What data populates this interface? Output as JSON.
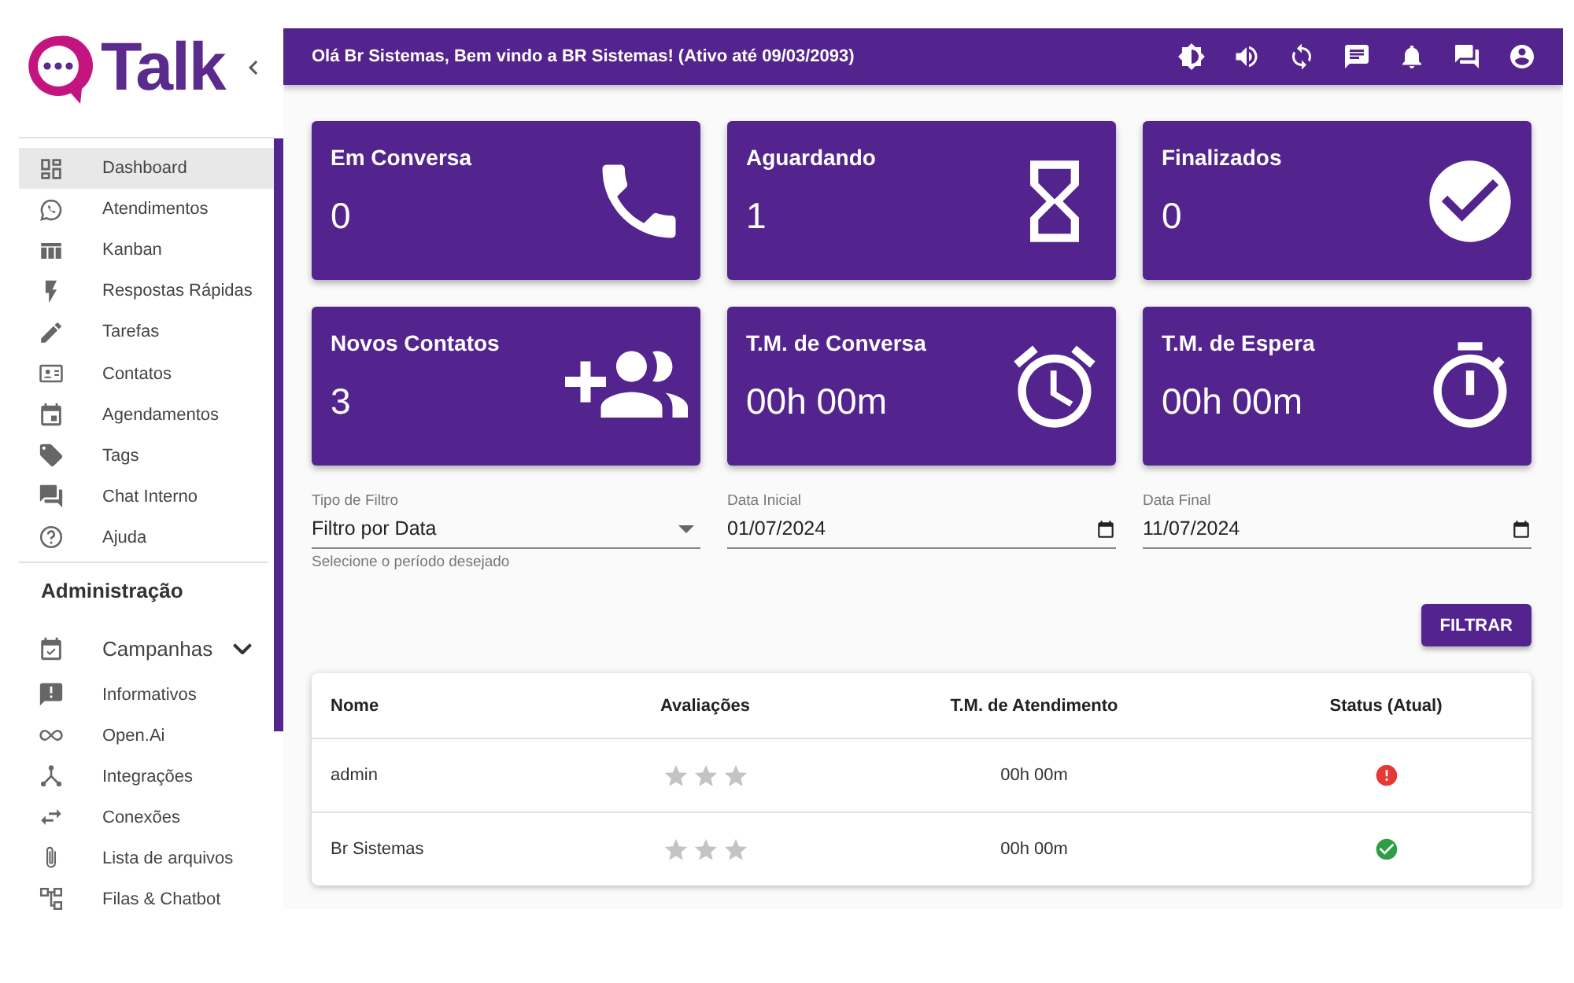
{
  "sidebar": {
    "logo_text": "Talk",
    "main_items": [
      {
        "label": "Dashboard",
        "selected": true
      },
      {
        "label": "Atendimentos",
        "selected": false
      },
      {
        "label": "Kanban",
        "selected": false
      },
      {
        "label": "Respostas Rápidas",
        "selected": false
      },
      {
        "label": "Tarefas",
        "selected": false
      },
      {
        "label": "Contatos",
        "selected": false
      },
      {
        "label": "Agendamentos",
        "selected": false
      },
      {
        "label": "Tags",
        "selected": false
      },
      {
        "label": "Chat Interno",
        "selected": false
      },
      {
        "label": "Ajuda",
        "selected": false
      }
    ],
    "admin_heading": "Administração",
    "admin_items": [
      {
        "label": "Campanhas",
        "kind": "group",
        "expanded": false,
        "selected": false
      },
      {
        "label": "Informativos",
        "kind": "link",
        "selected": false
      },
      {
        "label": "Open.Ai",
        "kind": "link",
        "selected": false
      },
      {
        "label": "Integrações",
        "kind": "link",
        "selected": false
      },
      {
        "label": "Conexões",
        "kind": "link",
        "selected": false
      },
      {
        "label": "Lista de arquivos",
        "kind": "link",
        "selected": false
      },
      {
        "label": "Filas & Chatbot",
        "kind": "link",
        "selected": false
      }
    ]
  },
  "header": {
    "greeting": "Olá Br Sistemas, Bem vindo a BR Sistemas! (Ativo até 09/03/2093)"
  },
  "stat_cards": [
    {
      "title": "Em Conversa",
      "value": "0"
    },
    {
      "title": "Aguardando",
      "value": "1"
    },
    {
      "title": "Finalizados",
      "value": "0"
    },
    {
      "title": "Novos Contatos",
      "value": "3"
    },
    {
      "title": "T.M. de Conversa",
      "value": "00h 00m"
    },
    {
      "title": "T.M. de Espera",
      "value": "00h 00m"
    }
  ],
  "filters": {
    "filter_type": {
      "label": "Tipo de Filtro",
      "value": "Filtro por Data",
      "helper": "Selecione o período desejado"
    },
    "start_date": {
      "label": "Data Inicial",
      "value": "01/07/2024"
    },
    "end_date": {
      "label": "Data Final",
      "value": "11/07/2024"
    },
    "button": "FILTRAR"
  },
  "table": {
    "columns": [
      "Nome",
      "Avaliações",
      "T.M. de Atendimento",
      "Status (Atual)"
    ],
    "rows": [
      {
        "name": "admin",
        "stars": 0,
        "avg_time": "00h 00m",
        "online": false
      },
      {
        "name": "Br Sistemas",
        "stars": 0,
        "avg_time": "00h 00m",
        "online": true
      }
    ]
  }
}
